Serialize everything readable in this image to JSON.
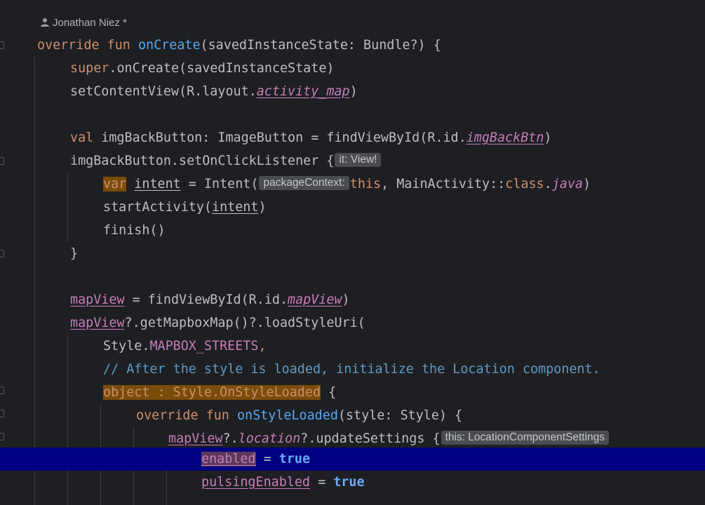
{
  "author": {
    "name": "Jonathan Niez *"
  },
  "lines": [
    [
      "override",
      "fun",
      "onCreate",
      "(savedInstanceState: Bundle?) {"
    ],
    [
      "super",
      ".onCreate(savedInstanceState)"
    ],
    [
      "setContentView(R.layout.",
      "activity_map",
      ")"
    ],
    [],
    [
      "val",
      " imgBackButton: ImageButton = findViewById(R.id.",
      "imgBackBtn",
      ")"
    ],
    [
      "imgBackButton.setOnClickListener {",
      "it: View!"
    ],
    [
      "var",
      "intent",
      " = Intent(",
      "packageContext:",
      "this",
      ", MainActivity::",
      "class",
      ".",
      "java",
      ")"
    ],
    [
      "startActivity(",
      "intent",
      ")"
    ],
    [
      "finish()"
    ],
    [
      "}"
    ],
    [],
    [
      "mapView",
      " = findViewById(R.id.",
      "mapView",
      ")"
    ],
    [
      "mapView",
      "?.getMapboxMap()?.loadStyleUri("
    ],
    [
      "Style.",
      "MAPBOX_STREETS",
      ","
    ],
    [
      "// After the style is loaded, initialize the Location component."
    ],
    [
      "object : Style.OnStyleLoaded",
      " {"
    ],
    [
      "override",
      "fun",
      "onStyleLoaded",
      "(style: Style) {"
    ],
    [
      "mapView",
      "?.",
      "location",
      "?.updateSettings {",
      "this: LocationComponentSettings"
    ],
    [
      "enabled",
      " = ",
      "true"
    ],
    [
      "pulsingEnabled",
      " = ",
      "true"
    ]
  ]
}
